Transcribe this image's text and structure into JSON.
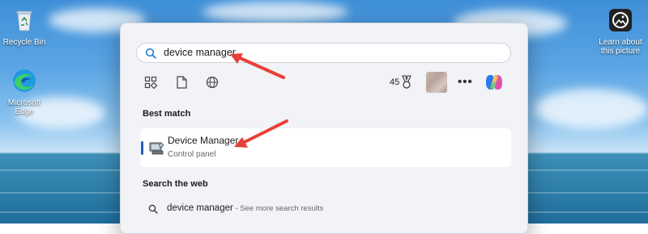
{
  "desktop": {
    "icons": [
      {
        "label": "Recycle Bin",
        "icon": "recycle-bin-icon"
      },
      {
        "label": "Microsoft Edge",
        "icon": "edge-icon"
      },
      {
        "label": "Learn about this picture",
        "icon": "learn-picture-icon"
      }
    ]
  },
  "start": {
    "search": {
      "value": "device manager",
      "icon": "search-icon"
    },
    "filters": [
      {
        "name": "apps",
        "icon": "apps-grid-icon"
      },
      {
        "name": "documents",
        "icon": "document-icon"
      },
      {
        "name": "web",
        "icon": "globe-icon"
      }
    ],
    "rewards": {
      "points": "45",
      "icon": "rewards-medal-icon"
    },
    "more_label": "•••",
    "best_match": {
      "heading": "Best match",
      "title": "Device Manager",
      "subtitle": "Control panel",
      "icon": "device-manager-icon"
    },
    "web": {
      "heading": "Search the web",
      "query": "device manager",
      "hint": " - See more search results",
      "icon": "search-icon"
    }
  },
  "colors": {
    "accent": "#1f5fbf",
    "arrow": "#e8403a",
    "panel_bg": "#f1f3f6"
  }
}
